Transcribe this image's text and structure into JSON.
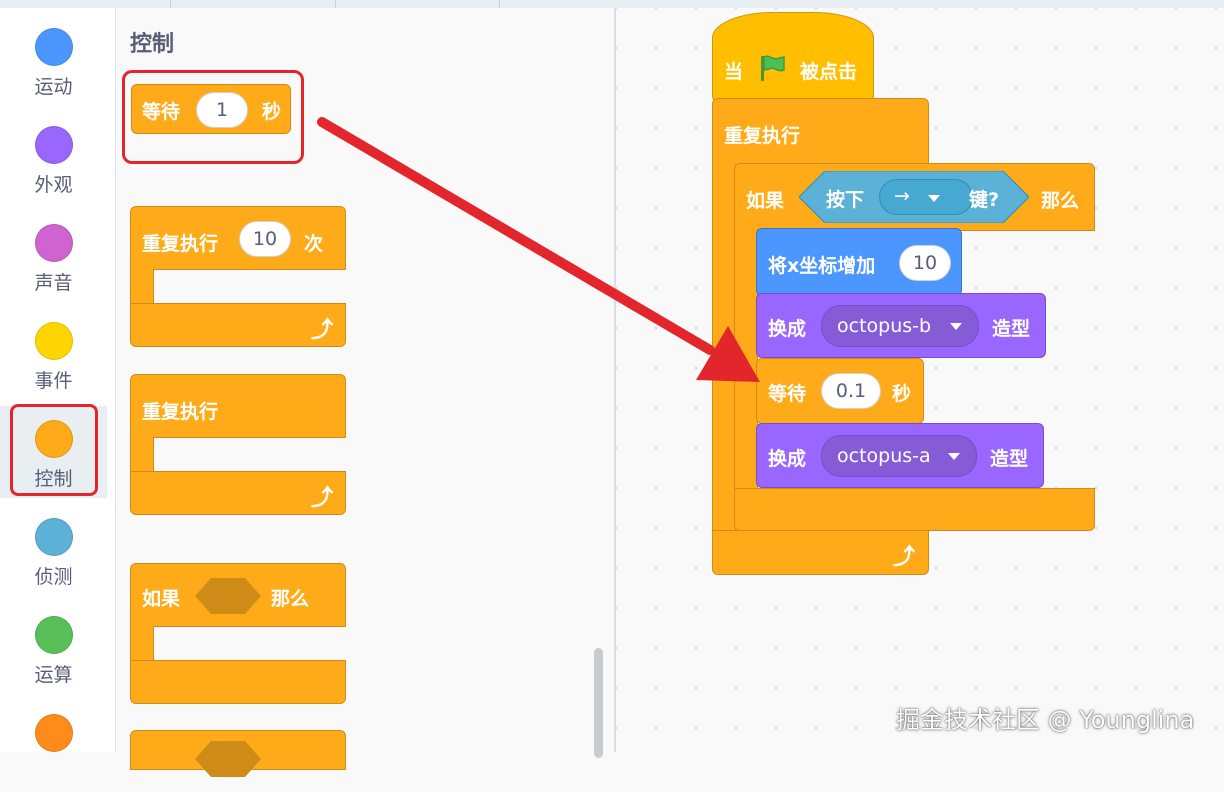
{
  "categories": [
    {
      "label": "运动",
      "color": "#4c97ff"
    },
    {
      "label": "外观",
      "color": "#9966ff"
    },
    {
      "label": "声音",
      "color": "#cf63cf"
    },
    {
      "label": "事件",
      "color": "#ffd500"
    },
    {
      "label": "控制",
      "color": "#ffab19"
    },
    {
      "label": "侦测",
      "color": "#5cb1d6"
    },
    {
      "label": "运算",
      "color": "#59c059"
    },
    {
      "label": "",
      "color": "#ff8c1a"
    }
  ],
  "palette": {
    "title": "控制",
    "wait": {
      "label": "等待",
      "value": "1",
      "unit": "秒"
    },
    "repeat_n": {
      "label": "重复执行",
      "value": "10",
      "unit": "次"
    },
    "forever": {
      "label": "重复执行"
    },
    "if_then": {
      "label_if": "如果",
      "label_then": "那么"
    }
  },
  "script": {
    "hat": {
      "pre": "当",
      "post": "被点击"
    },
    "forever": {
      "label": "重复执行"
    },
    "if_block": {
      "label_if": "如果",
      "label_then": "那么"
    },
    "key_pressed": {
      "pre": "按下",
      "key": "→",
      "post": "键?"
    },
    "change_x": {
      "label": "将x坐标增加",
      "value": "10"
    },
    "switch_costume_1": {
      "pre": "换成",
      "costume": "octopus-b",
      "post": "造型"
    },
    "wait": {
      "label": "等待",
      "value": "0.1",
      "unit": "秒"
    },
    "switch_costume_2": {
      "pre": "换成",
      "costume": "octopus-a",
      "post": "造型"
    }
  },
  "watermark": "掘金技术社区 @ Younglina",
  "colors": {
    "highlight": "#e3262c",
    "control": "#ffab19",
    "motion": "#4c97ff",
    "looks": "#9966ff",
    "sensing": "#5cb1d6"
  }
}
